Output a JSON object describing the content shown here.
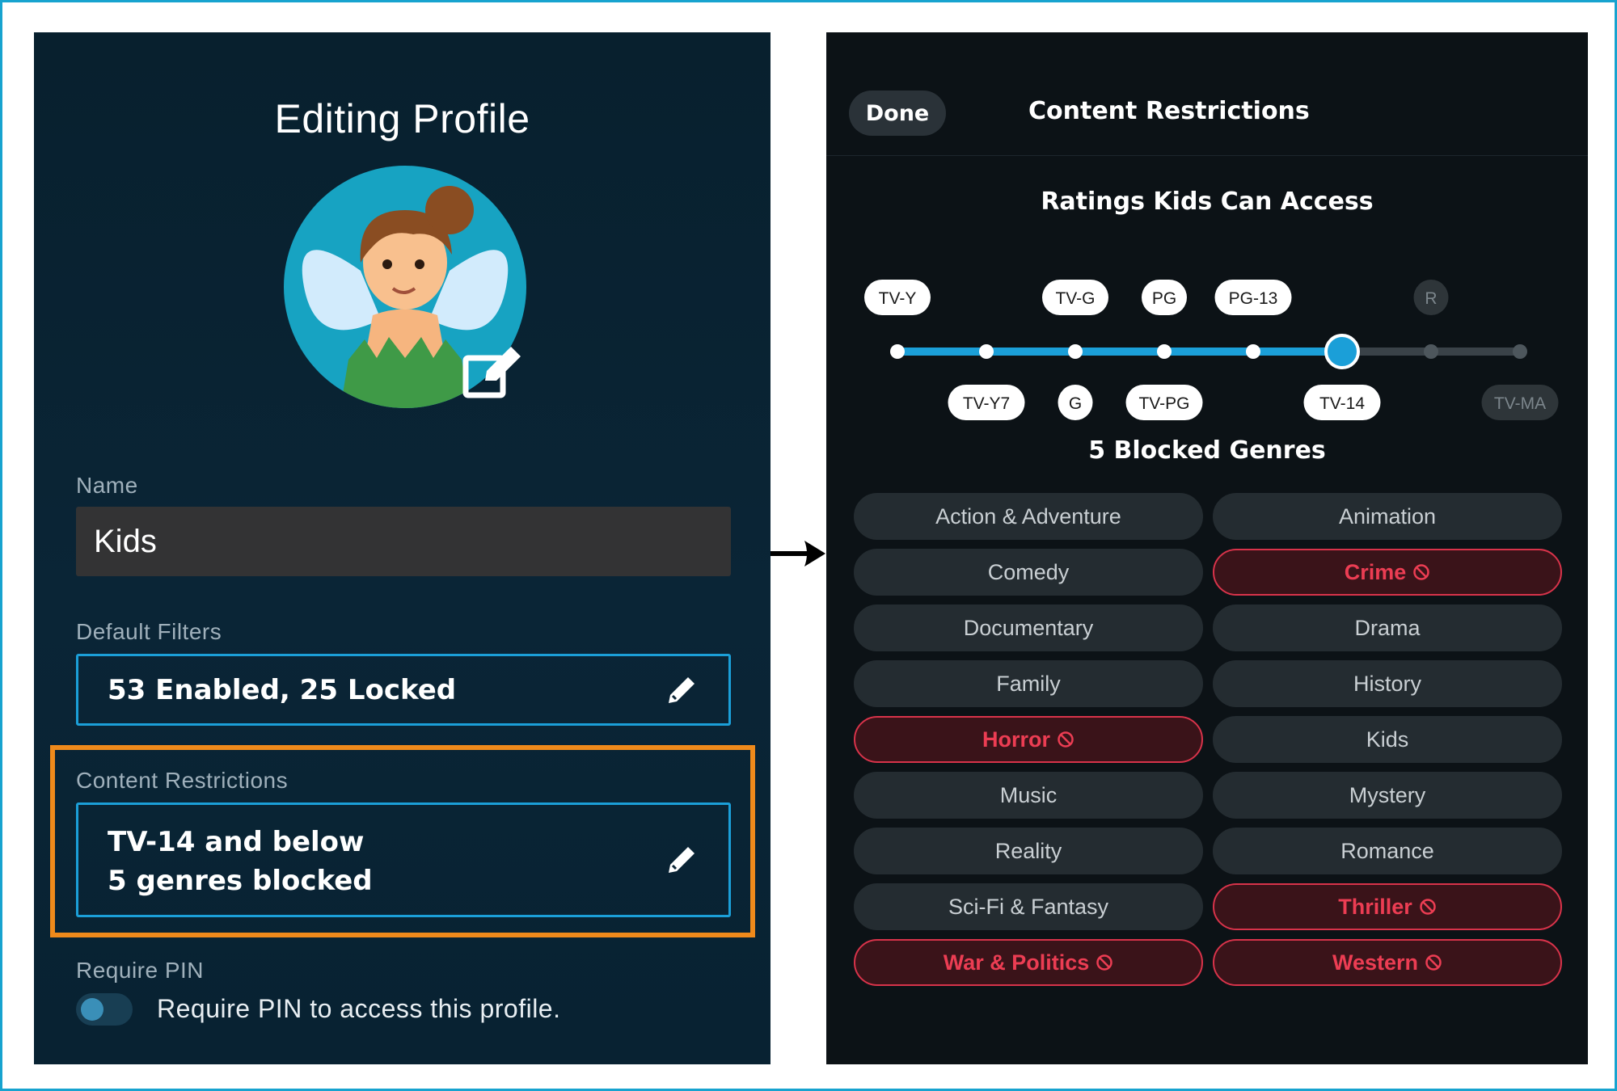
{
  "profile_editor": {
    "title": "Editing Profile",
    "name_label": "Name",
    "name_value": "Kids",
    "default_filters_label": "Default Filters",
    "default_filters_value": "53 Enabled, 25 Locked",
    "content_restrictions_label": "Content Restrictions",
    "content_restrictions_line1": "TV-14 and below",
    "content_restrictions_line2": "5 genres blocked",
    "require_pin_label": "Require PIN",
    "require_pin_text": "Require PIN to access this profile.",
    "require_pin_enabled": false
  },
  "content_restrictions": {
    "done_label": "Done",
    "title": "Content Restrictions",
    "ratings_heading": "Ratings Kids Can Access",
    "selected_rating": "TV-14",
    "ratings": [
      {
        "top": "TV-Y",
        "bottom": "",
        "active": true
      },
      {
        "top": "",
        "bottom": "TV-Y7",
        "active": true
      },
      {
        "top": "TV-G",
        "bottom": "G",
        "active": true
      },
      {
        "top": "PG",
        "bottom": "TV-PG",
        "active": true
      },
      {
        "top": "PG-13",
        "bottom": "",
        "active": true
      },
      {
        "top": "",
        "bottom": "TV-14",
        "active": true
      },
      {
        "top": "R",
        "bottom": "",
        "active": false
      },
      {
        "top": "",
        "bottom": "TV-MA",
        "active": false
      }
    ],
    "genres_heading": "5 Blocked Genres",
    "genres": [
      {
        "label": "Action & Adventure",
        "blocked": false
      },
      {
        "label": "Animation",
        "blocked": false
      },
      {
        "label": "Comedy",
        "blocked": false
      },
      {
        "label": "Crime",
        "blocked": true
      },
      {
        "label": "Documentary",
        "blocked": false
      },
      {
        "label": "Drama",
        "blocked": false
      },
      {
        "label": "Family",
        "blocked": false
      },
      {
        "label": "History",
        "blocked": false
      },
      {
        "label": "Horror",
        "blocked": true
      },
      {
        "label": "Kids",
        "blocked": false
      },
      {
        "label": "Music",
        "blocked": false
      },
      {
        "label": "Mystery",
        "blocked": false
      },
      {
        "label": "Reality",
        "blocked": false
      },
      {
        "label": "Romance",
        "blocked": false
      },
      {
        "label": "Sci-Fi & Fantasy",
        "blocked": false
      },
      {
        "label": "Thriller",
        "blocked": true
      },
      {
        "label": "War & Politics",
        "blocked": true
      },
      {
        "label": "Western",
        "blocked": true
      }
    ]
  },
  "colors": {
    "accent": "#1b9fd8",
    "highlight": "#ef8a1b",
    "blocked": "#ec3d53",
    "left_bg": "#0a2536",
    "right_bg": "#0c1216"
  }
}
